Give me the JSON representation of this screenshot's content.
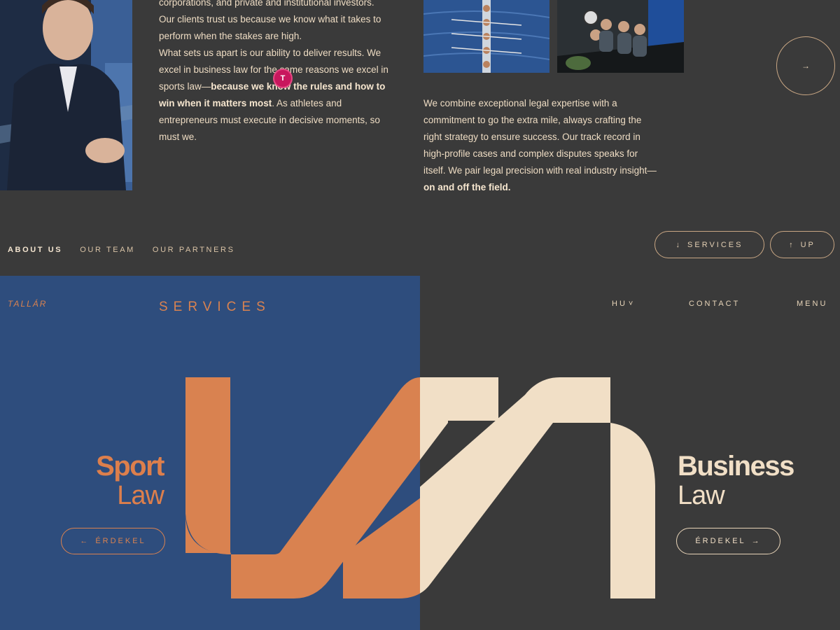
{
  "about": {
    "para1_lines": [
      "corporations, and private and institutional investors.",
      "Our clients trust us because we know what it takes to",
      "perform when the stakes are high."
    ],
    "para2_start": "What sets us apart is our ability to deliver results. We excel in business law for the same reasons we excel in sports law—",
    "para2_bold": "because we know the rules and how to win when it matters most",
    "para2_end": ". As athletes and entrepreneurs must execute in decisive moments, so must we.",
    "para3_start": "We combine exceptional legal expertise with a commitment to go the extra mile, always crafting the right strategy to ensure success. Our track record in high-profile cases and complex disputes speaks for itself. We pair legal precision with real industry insight—",
    "para3_bold": "on and off the field."
  },
  "cursor_badge": "T",
  "next_arrow": "→",
  "subnav": {
    "items": [
      "ABOUT US",
      "OUR TEAM",
      "OUR PARTNERS"
    ],
    "active": "ABOUT US"
  },
  "pills": {
    "services_icon": "↓",
    "services_label": "SERVICES",
    "up_icon": "↑",
    "up_label": "UP"
  },
  "services": {
    "logo": "TALLÁR",
    "title": "SERVICES",
    "nav": {
      "lang": "HU",
      "lang_icon": "˅",
      "contact": "CONTACT",
      "menu": "MENU"
    },
    "sport": {
      "bold": "Sport",
      "light": "Law",
      "cta": "ÉRDEKEL",
      "cta_icon": "←"
    },
    "business": {
      "bold": "Business",
      "light": "Law",
      "cta": "ÉRDEKEL",
      "cta_icon": "→"
    }
  },
  "colors": {
    "dark_bg": "#3a3a3a",
    "blue": "#2e4d7d",
    "orange": "#d98250",
    "cream": "#f1dfc6"
  }
}
